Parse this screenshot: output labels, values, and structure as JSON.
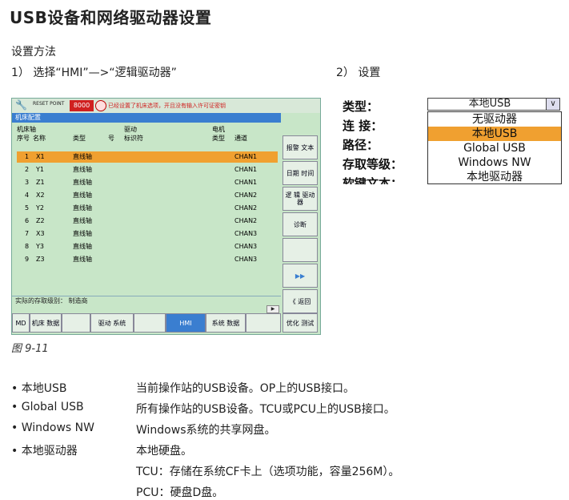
{
  "title": "USB设备和网络驱动器设置",
  "method_label": "设置方法",
  "step1": "1） 选择“HMI”—>“逻辑驱动器”",
  "step2": "2） 设置",
  "hmi": {
    "reset_label": "RESET POINT",
    "alarm_number": "8000",
    "alarm_text": "已经设置了机床选项，开且没有输入许可证密钥",
    "panel_title": "机床配置",
    "headers": {
      "axis_group": "机床轴",
      "drive_group": "驱动",
      "motor_group": "电机",
      "seq": "序号",
      "name": "名称",
      "type": "类型",
      "no": "号",
      "id": "标识符",
      "motor_type": "类型",
      "channel": "通道"
    },
    "rows": [
      {
        "seq": "1",
        "name": "X1",
        "type": "直线轴",
        "channel": "CHAN1"
      },
      {
        "seq": "2",
        "name": "Y1",
        "type": "直线轴",
        "channel": "CHAN1"
      },
      {
        "seq": "3",
        "name": "Z1",
        "type": "直线轴",
        "channel": "CHAN1"
      },
      {
        "seq": "4",
        "name": "X2",
        "type": "直线轴",
        "channel": "CHAN2"
      },
      {
        "seq": "5",
        "name": "Y2",
        "type": "直线轴",
        "channel": "CHAN2"
      },
      {
        "seq": "6",
        "name": "Z2",
        "type": "直线轴",
        "channel": "CHAN2"
      },
      {
        "seq": "7",
        "name": "X3",
        "type": "直线轴",
        "channel": "CHAN3"
      },
      {
        "seq": "8",
        "name": "Y3",
        "type": "直线轴",
        "channel": "CHAN3"
      },
      {
        "seq": "9",
        "name": "Z3",
        "type": "直线轴",
        "channel": "CHAN3"
      }
    ],
    "status": "实际的存取级别： 制造商",
    "softkeys": {
      "report_text": "报警 文本",
      "datetime": "日期 时间",
      "logical_drive": "逻 辑 驱动器",
      "diagnosis": "诊断",
      "forward": "▶▶",
      "back": "《 返回"
    },
    "hkeys": {
      "md": "MD",
      "machine_data": "机床 数据",
      "drive_system": "驱动 系统",
      "hmi": "HMI",
      "system_data": "系统 数据",
      "optimize": "优化 测试"
    }
  },
  "dropdown": {
    "labels": [
      "类型：",
      "连 接：",
      "路径：",
      "存取等级：",
      "软键文本："
    ],
    "selected_value": "本地USB",
    "options": [
      "无驱动器",
      "本地USB",
      "Global USB",
      "Windows NW",
      "本地驱动器"
    ],
    "highlighted_index": 1
  },
  "figure_caption": "图 9-11",
  "bullets": [
    {
      "label": "本地USB",
      "desc": "当前操作站的USB设备。OP上的USB接口。"
    },
    {
      "label": "Global USB",
      "desc": "所有操作站的USB设备。TCU或PCU上的USB接口。"
    },
    {
      "label": "Windows NW",
      "desc": "Windows系统的共享网盘。"
    },
    {
      "label": "本地驱动器",
      "desc": "本地硬盘。"
    }
  ],
  "bullet_extra": "TCU：存储在系统CF卡上（选项功能，容量256M）。",
  "bullet_extra2": "PCU：硬盘D盘。"
}
